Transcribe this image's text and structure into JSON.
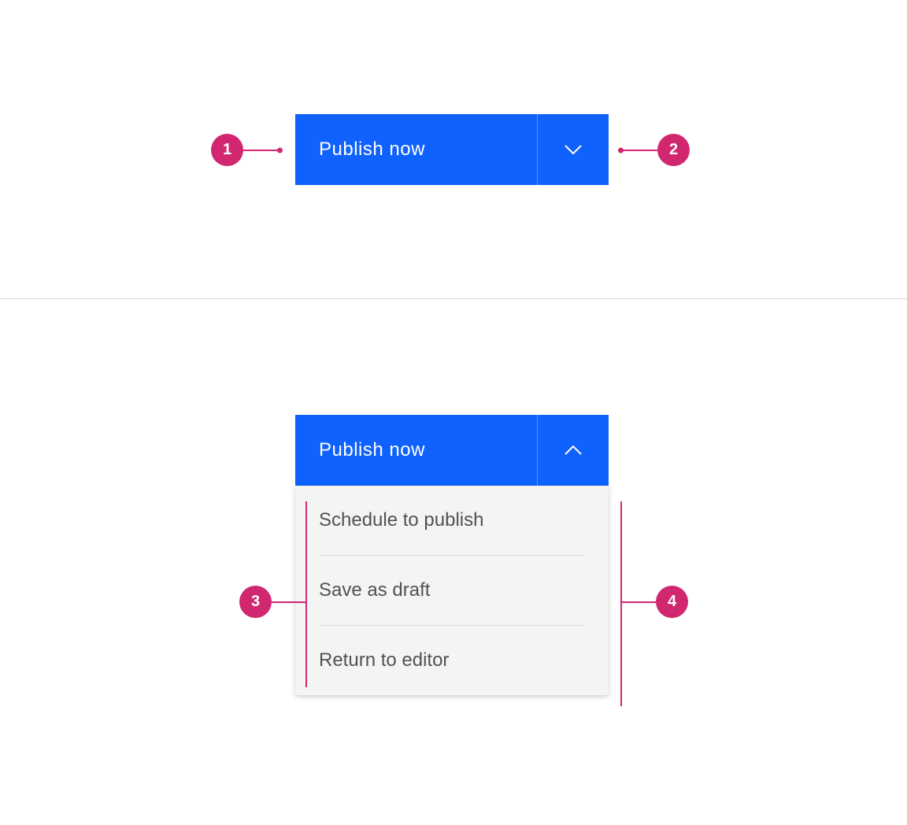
{
  "colors": {
    "primary": "#0f62fe",
    "annotation": "#d12771",
    "menu_bg": "#f4f4f4",
    "text_light": "#ffffff",
    "text_menu": "#525252"
  },
  "closed": {
    "primary_label": "Publish now"
  },
  "open": {
    "primary_label": "Publish now",
    "items": [
      {
        "label": "Schedule to publish"
      },
      {
        "label": "Save as draft"
      },
      {
        "label": "Return to editor"
      }
    ]
  },
  "annotations": {
    "a1": "1",
    "a2": "2",
    "a3": "3",
    "a4": "4"
  }
}
